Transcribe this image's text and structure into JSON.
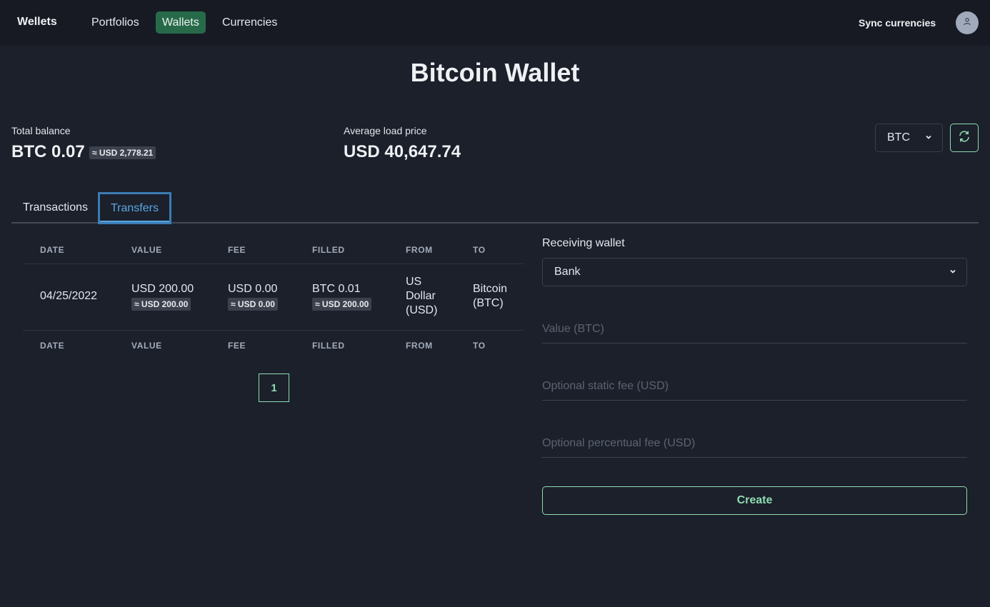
{
  "nav": {
    "brand": "Wellets",
    "items": [
      {
        "label": "Portfolios",
        "active": false
      },
      {
        "label": "Wallets",
        "active": true
      },
      {
        "label": "Currencies",
        "active": false
      }
    ],
    "sync_label": "Sync currencies",
    "avatar_icon": "user-icon"
  },
  "page": {
    "title": "Bitcoin Wallet"
  },
  "stats": {
    "total_balance_label": "Total balance",
    "total_balance_value": "BTC 0.07",
    "total_balance_converted": "≈ USD 2,778.21",
    "avg_price_label": "Average load price",
    "avg_price_value": "USD 40,647.74"
  },
  "currency_select": {
    "value": "BTC",
    "icon": "chevron-down-icon"
  },
  "refresh_icon": "refresh-icon",
  "tabs": [
    {
      "label": "Transactions",
      "active": false
    },
    {
      "label": "Transfers",
      "active": true
    }
  ],
  "table": {
    "headers": [
      "DATE",
      "VALUE",
      "FEE",
      "FILLED",
      "FROM",
      "TO"
    ],
    "rows": [
      {
        "date": "04/25/2022",
        "value": "USD 200.00",
        "value_converted": "≈ USD 200.00",
        "fee": "USD 0.00",
        "fee_converted": "≈ USD 0.00",
        "filled": "BTC 0.01",
        "filled_converted": "≈ USD 200.00",
        "from": "US Dollar (USD)",
        "to": "Bitcoin (BTC)"
      }
    ]
  },
  "pagination": {
    "current_page": "1"
  },
  "form": {
    "receiving_wallet_label": "Receiving wallet",
    "receiving_wallet_value": "Bank",
    "value_placeholder": "Value (BTC)",
    "static_fee_placeholder": "Optional static fee (USD)",
    "percentual_fee_placeholder": "Optional percentual fee (USD)",
    "create_label": "Create"
  },
  "colors": {
    "background": "#1b202b",
    "topbar": "#171a23",
    "accent_green": "#8fdcb0",
    "active_nav": "#276a4a",
    "active_tab": "#5aa6e3"
  }
}
